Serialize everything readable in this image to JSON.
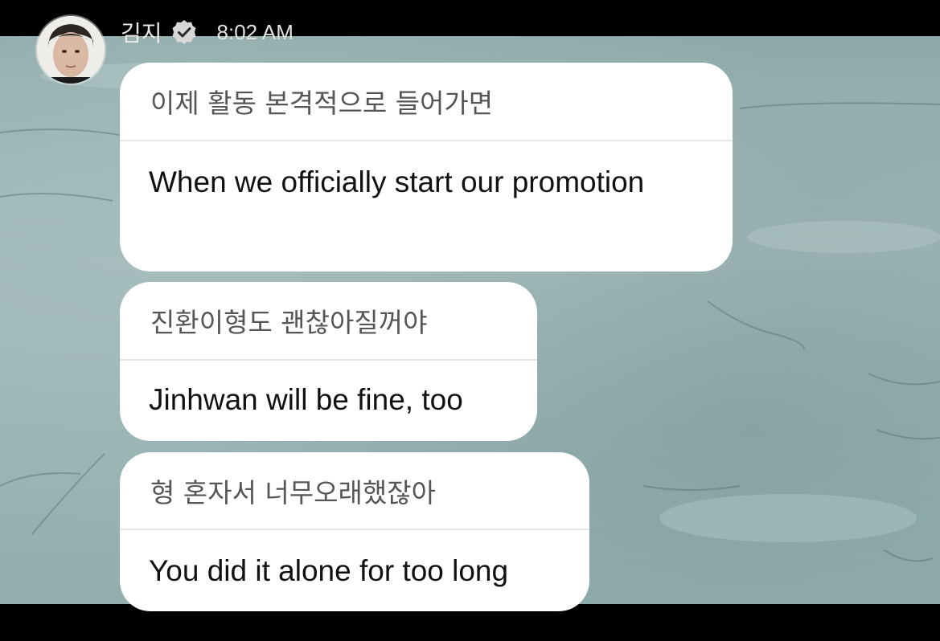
{
  "header": {
    "sender_name": "김지",
    "time": "8:02 AM",
    "verified_icon": "verified-badge-icon",
    "avatar_icon": "profile-avatar"
  },
  "messages": [
    {
      "original": "이제 활동 본격적으로 들어가면",
      "translation": "When we officially start our promotion"
    },
    {
      "original": "진환이형도 괜찮아질꺼야",
      "translation": "Jinhwan will be fine, too"
    },
    {
      "original": "형 혼자서 너무오래했잖아",
      "translation": "You did it alone for too long"
    }
  ],
  "colors": {
    "bubble_bg": "#ffffff",
    "original_text": "#555555",
    "translation_text": "#111111",
    "header_text": "#e9e9e9",
    "background": "#9bb3b2"
  }
}
